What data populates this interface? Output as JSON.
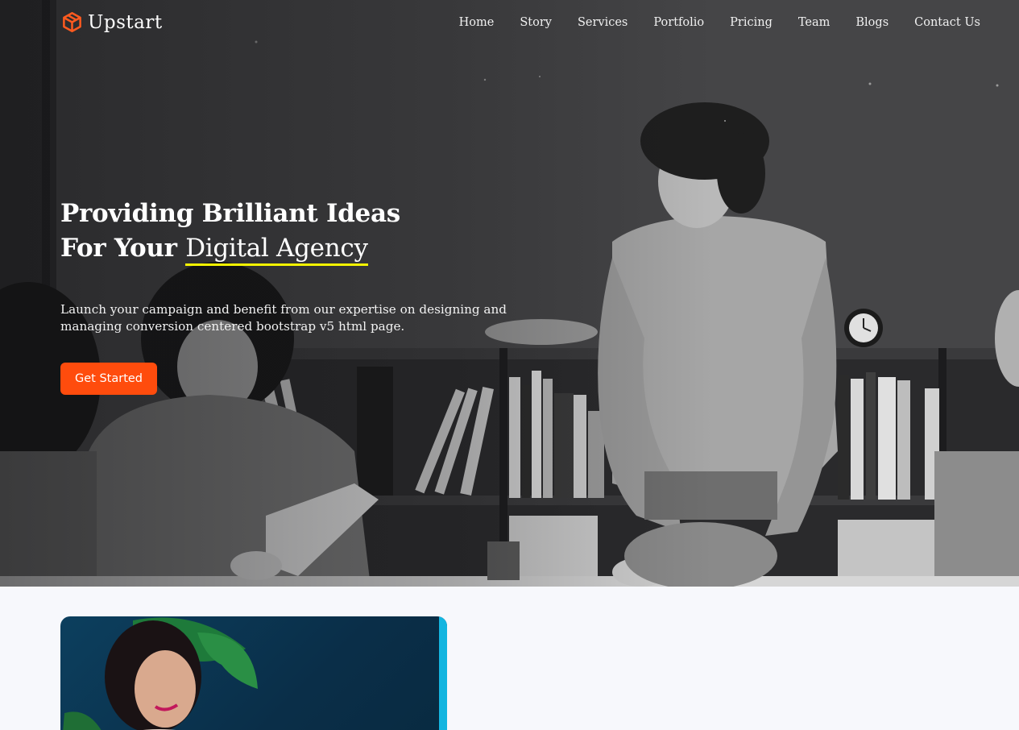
{
  "brand": {
    "name": "Upstart",
    "accent_color": "#ff5a1f"
  },
  "nav": {
    "items": [
      "Home",
      "Story",
      "Services",
      "Portfolio",
      "Pricing",
      "Team",
      "Blogs",
      "Contact Us"
    ]
  },
  "hero": {
    "headline_line1": "Providing Brilliant Ideas",
    "headline_line2_prefix": "For Your ",
    "headline_accent": "Digital Agency",
    "accent_underline_color": "#f5f500",
    "lead": "Launch your campaign and benefit from our expertise on designing and managing conversion centered bootstrap v5 html page.",
    "cta_label": "Get Started",
    "cta_color": "#ff4c0d"
  },
  "icons": {
    "logo": "cube-logo-icon"
  },
  "colors": {
    "section_bg": "#f7f8fc",
    "card_edge": "#13b5e0"
  }
}
